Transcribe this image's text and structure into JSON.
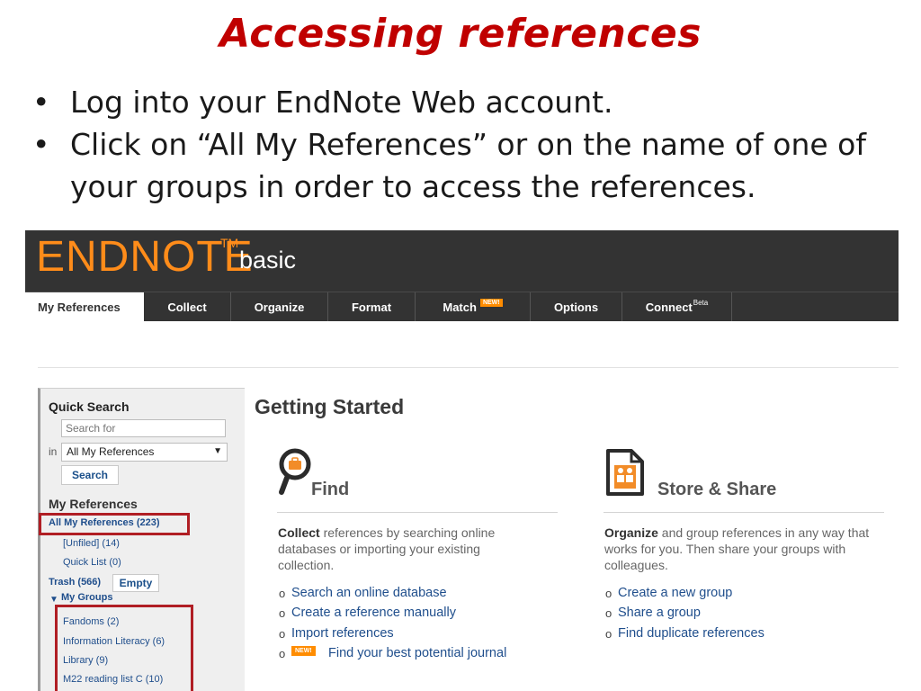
{
  "slide": {
    "title": "Accessing references",
    "bullets": [
      "Log into your EndNote Web account.",
      "Click on “All My References” or on the name of one of your groups in order to access the references."
    ],
    "bullet_char": "•"
  },
  "app": {
    "logo_main": "ENDNOTE",
    "logo_tm": "TM",
    "logo_sub": "basic",
    "tabs": [
      {
        "label": "My References",
        "active": true
      },
      {
        "label": "Collect"
      },
      {
        "label": "Organize"
      },
      {
        "label": "Format"
      },
      {
        "label": "Match",
        "badge": "NEW!"
      },
      {
        "label": "Options"
      },
      {
        "label": "Connect",
        "sup": "Beta"
      }
    ]
  },
  "sidebar": {
    "quick_search_title": "Quick Search",
    "search_placeholder": "Search for",
    "in_label": "in",
    "scope_selected": "All My References",
    "search_button": "Search",
    "my_refs_title": "My References",
    "all_refs": "All My References (223)",
    "unfiled": "[Unfiled] (14)",
    "quick_list": "Quick List (0)",
    "trash": "Trash (566)",
    "empty_button": "Empty",
    "my_groups": "My Groups",
    "groups": [
      "Fandoms (2)",
      "Information Literacy (6)",
      "Library (9)",
      "M22 reading list C (10)"
    ]
  },
  "main": {
    "title": "Getting Started",
    "find": {
      "title": "Find",
      "desc_bold": "Collect",
      "desc_rest": " references by searching online databases or importing your existing collection.",
      "links": [
        "Search an online database",
        "Create a reference manually",
        "Import references",
        "Find your best potential journal"
      ],
      "new_badge": "NEW!"
    },
    "store": {
      "title": "Store & Share",
      "desc_bold": "Organize",
      "desc_rest": " and group references in any way that works for you. Then share your groups with colleagues.",
      "links": [
        "Create a new group",
        "Share a group",
        "Find duplicate references"
      ]
    }
  },
  "colors": {
    "title_red": "#c00000",
    "brand_orange": "#ff8c1a",
    "banner_dark": "#333333",
    "link_blue": "#1f4e8c",
    "highlight_red": "#b01e24"
  }
}
